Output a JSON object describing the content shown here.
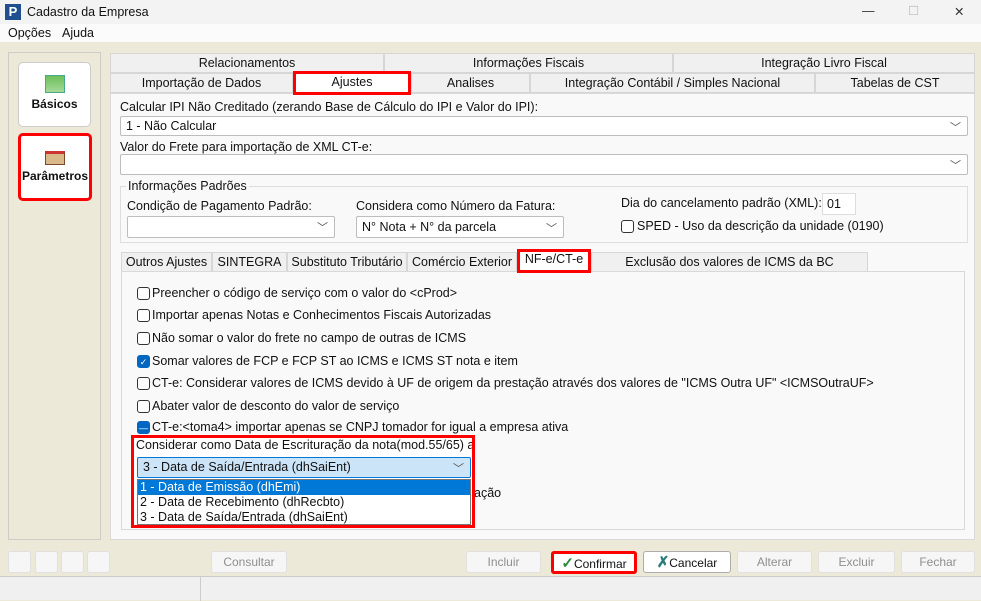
{
  "window": {
    "title": "Cadastro da Empresa",
    "min": "—",
    "max": "☐",
    "close": "✕"
  },
  "menu": [
    "Opções",
    "Ajuda"
  ],
  "sidebar": [
    {
      "label": "Básicos",
      "icon": "table-icon"
    },
    {
      "label": "Parâmetros",
      "icon": "book-icon"
    }
  ],
  "tabs_row1": [
    "Relacionamentos",
    "Informações Fiscais",
    "Integração Livro Fiscal"
  ],
  "tabs_row2": [
    "Importação de Dados",
    "Ajustes",
    "Analises",
    "Integração Contábil / Simples Nacional",
    "Tabelas de CST"
  ],
  "ipi": {
    "label": "Calcular IPI Não Creditado (zerando Base de Cálculo do IPI e Valor do IPI):",
    "value": "1 - Não Calcular"
  },
  "frete": {
    "label": "Valor do Frete para importação de XML CT-e:",
    "value": ""
  },
  "info": {
    "legend": "Informações Padrões",
    "cond_label": "Condição de Pagamento Padrão:",
    "cond_value": "",
    "fatura_label": "Considera como Número da Fatura:",
    "fatura_value": "N° Nota + N° da parcela",
    "dia_label": "Dia do cancelamento padrão (XML):",
    "dia_value": "01",
    "sped_label": "SPED - Uso da descrição da unidade (0190)"
  },
  "subtabs": [
    "Outros Ajustes",
    "SINTEGRA",
    "Substituto Tributário",
    "Comércio Exterior",
    "NF-e/CT-e",
    "Exclusão dos valores de ICMS da BC PIS/COFINS"
  ],
  "checks": [
    {
      "label": "Preencher o código de serviço com o valor do <cProd>",
      "state": "unchecked"
    },
    {
      "label": "Importar apenas Notas e Conhecimentos Fiscais Autorizadas",
      "state": "unchecked"
    },
    {
      "label": "Não somar o valor do frete no campo de outras de ICMS",
      "state": "unchecked"
    },
    {
      "label": "Somar valores de FCP e FCP ST ao ICMS e ICMS ST nota e item",
      "state": "checked"
    },
    {
      "label": "CT-e: Considerar valores de ICMS devido à UF de origem da prestação através dos valores de \"ICMS Outra UF\" <ICMSOutraUF>",
      "state": "unchecked"
    },
    {
      "label": "Abater valor de desconto do valor de serviço",
      "state": "unchecked"
    },
    {
      "label": "CT-e:<toma4> importar apenas se CNPJ tomador for igual a empresa ativa",
      "state": "indeterminate"
    }
  ],
  "escrit": {
    "label": "Considerar como Data de Escrituração da nota(mod.55/65) a:",
    "value": "3 -  Data de Saída/Entrada (dhSaiEnt)",
    "options": [
      "1 -  Data de Emissão (dhEmi)",
      "2 -  Data de Recebimento (dhRecbto)",
      "3 -  Data de Saída/Entrada (dhSaiEnt)"
    ],
    "highlighted": 0,
    "hidden_text": "ação"
  },
  "buttons": {
    "consultar": "Consultar",
    "incluir": "Incluir",
    "confirmar": "Confirmar",
    "cancelar": "Cancelar",
    "alterar": "Alterar",
    "excluir": "Excluir",
    "fechar": "Fechar"
  },
  "colors": {
    "highlight": "#0078d7",
    "annotation": "#ff0000",
    "background": "#ece9d8"
  }
}
